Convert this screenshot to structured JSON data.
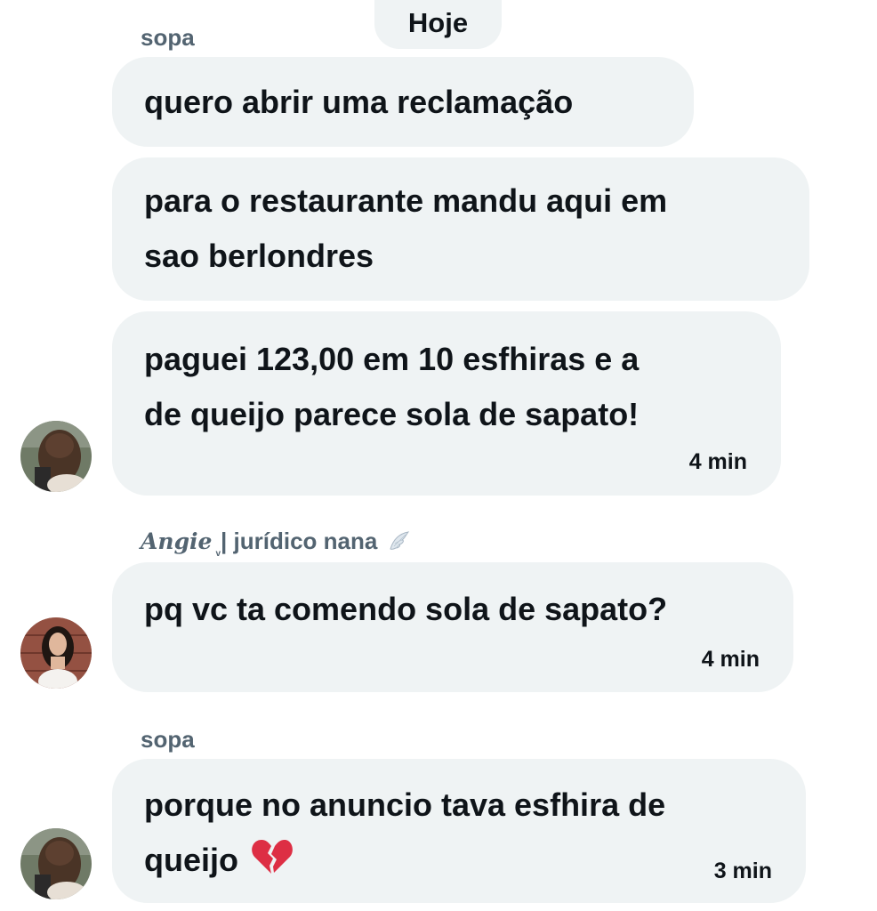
{
  "date_label": "Hoje",
  "groups": [
    {
      "sender": "sopa",
      "messages": [
        {
          "text": "quero abrir uma reclamação"
        },
        {
          "lines": [
            "para o restaurante mandu aqui em",
            "sao berlondres"
          ]
        },
        {
          "lines": [
            "paguei 123,00 em 10 esfhiras e a",
            "de queijo parece sola de sapato!"
          ],
          "time": "4 min"
        }
      ]
    },
    {
      "sender_italic": "Angie",
      "sender_sub": "v",
      "sender_rest": "| jurídico nana",
      "sender_emoji_icon": "angel-wing-icon",
      "messages": [
        {
          "text": "pq vc ta comendo sola de sapato?",
          "time": "4 min"
        }
      ]
    },
    {
      "sender": "sopa",
      "messages": [
        {
          "lines": [
            "porque no anuncio tava esfhira de",
            "queijo"
          ],
          "emoji_icon": "broken-heart-icon",
          "time": "3 min"
        }
      ]
    }
  ]
}
